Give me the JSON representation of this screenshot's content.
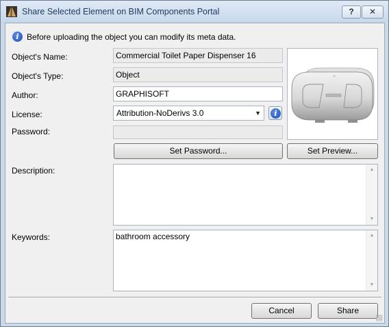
{
  "window": {
    "title": "Share Selected Element on BIM Components Portal",
    "help_label": "?",
    "close_label": "✕"
  },
  "info_message": "Before uploading the object you can modify its meta data.",
  "form": {
    "name_label": "Object's Name:",
    "name_value": "Commercial Toilet Paper Dispenser 16",
    "type_label": "Object's Type:",
    "type_value": "Object",
    "author_label": "Author:",
    "author_value": "GRAPHISOFT",
    "license_label": "License:",
    "license_value": "Attribution-NoDerivs 3.0",
    "password_label": "Password:",
    "password_value": "",
    "description_label": "Description:",
    "description_value": "",
    "keywords_label": "Keywords:",
    "keywords_value": "bathroom accessory"
  },
  "buttons": {
    "set_password": "Set Password...",
    "set_preview": "Set Preview...",
    "cancel": "Cancel",
    "share": "Share"
  },
  "icons": {
    "info": "i",
    "dropdown": "▼",
    "scroll_up": "▲",
    "scroll_down": "▼"
  }
}
